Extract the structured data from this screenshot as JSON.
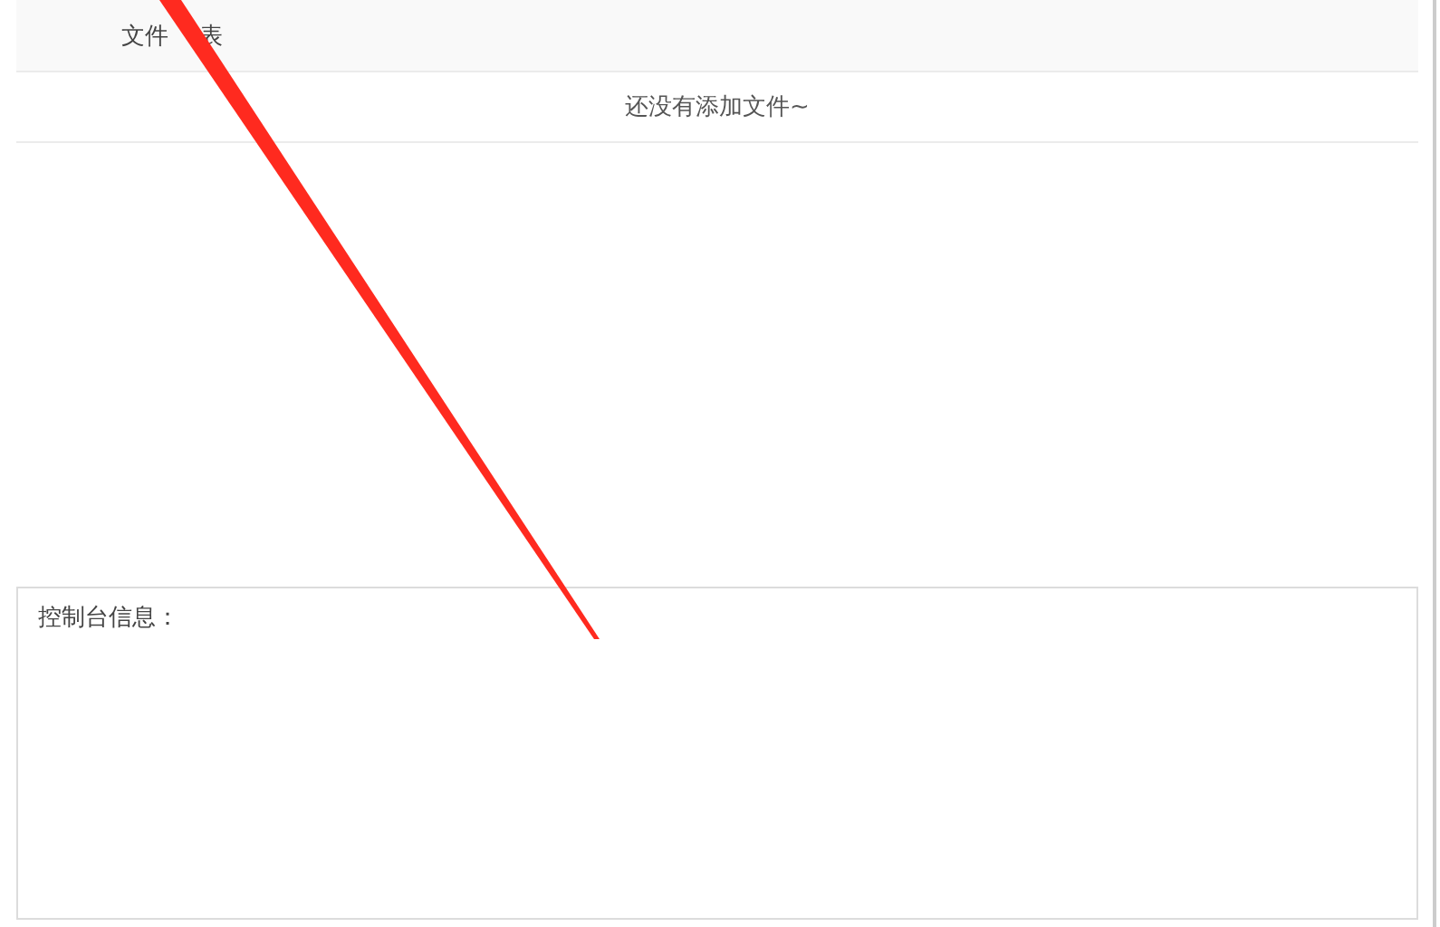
{
  "file_table": {
    "header_parts": [
      "文件",
      "表"
    ],
    "empty_message": "还没有添加文件~"
  },
  "console": {
    "label": "控制台信息："
  }
}
